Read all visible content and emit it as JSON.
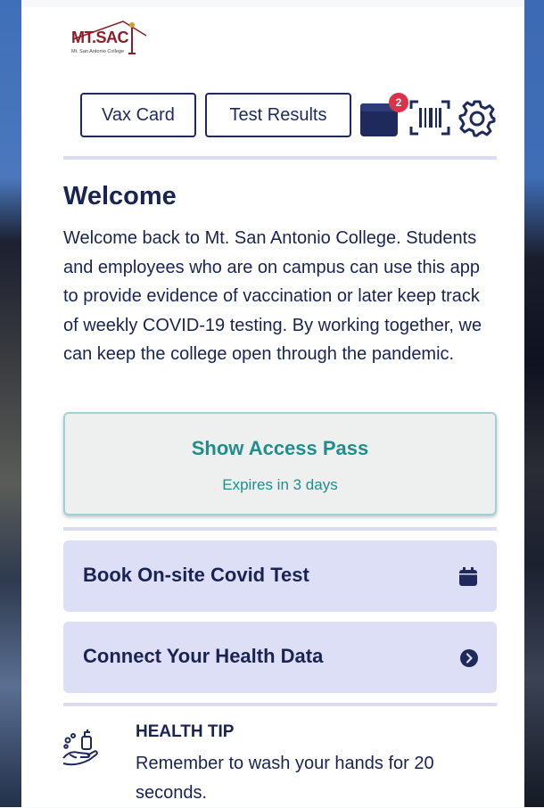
{
  "app": {
    "logo_text": "MT.SAC",
    "logo_subtext": "Mt. San Antonio College"
  },
  "toolbar": {
    "vax_card_label": "Vax Card",
    "test_results_label": "Test Results",
    "calendar_badge_count": "2",
    "icons": [
      "calendar-icon",
      "barcode-scan-icon",
      "gear-icon"
    ]
  },
  "welcome": {
    "title": "Welcome",
    "body": "Welcome back to Mt. San Antonio College. Students and employees who are on campus can use this app to provide evidence of vaccination or later keep track of weekly COVID-19 testing. By working together, we can keep the college open through the pandemic."
  },
  "access_pass": {
    "title": "Show Access Pass",
    "subtitle": "Expires in 3 days"
  },
  "actions": [
    {
      "label": "Book On-site Covid Test",
      "icon": "calendar-icon"
    },
    {
      "label": "Connect Your Health Data",
      "icon": "chevron-right-circle-icon"
    }
  ],
  "health_tip": {
    "title": "HEALTH TIP",
    "body": "Remember to wash your hands for 20 seconds.",
    "icon": "hand-wash-icon"
  },
  "colors": {
    "navy": "#1a2452",
    "teal": "#1f8f8c",
    "badge_red": "#d9334a",
    "lavender": "#dddff6",
    "logo_maroon": "#8a1f2a"
  }
}
